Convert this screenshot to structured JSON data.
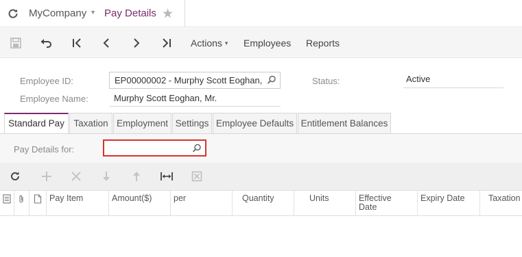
{
  "header": {
    "company": "MyCompany",
    "page_title": "Pay Details",
    "caret": "▾",
    "star": "★"
  },
  "toolbar": {
    "actions_label": "Actions",
    "employees_label": "Employees",
    "reports_label": "Reports",
    "caret": "▾"
  },
  "form": {
    "employee_id_label": "Employee ID:",
    "employee_id_value": "EP00000002 - Murphy Scott Eoghan,",
    "employee_name_label": "Employee Name:",
    "employee_name_value": "Murphy Scott Eoghan, Mr.",
    "status_label": "Status:",
    "status_value": "Active"
  },
  "tabs": [
    {
      "label": "Standard Pay",
      "active": true
    },
    {
      "label": "Taxation"
    },
    {
      "label": "Employment"
    },
    {
      "label": "Settings"
    },
    {
      "label": "Employee Defaults"
    },
    {
      "label": "Entitlement Balances"
    }
  ],
  "filter": {
    "label": "Pay Details for:",
    "value": ""
  },
  "grid": {
    "columns": [
      "Pay Item",
      "Amount($)",
      "per",
      "Quantity",
      "Units",
      "Effective Date",
      "Expiry Date",
      "Taxation"
    ],
    "rows": []
  },
  "colors": {
    "accent": "#7b2a6b",
    "error_border": "#d9322b"
  }
}
